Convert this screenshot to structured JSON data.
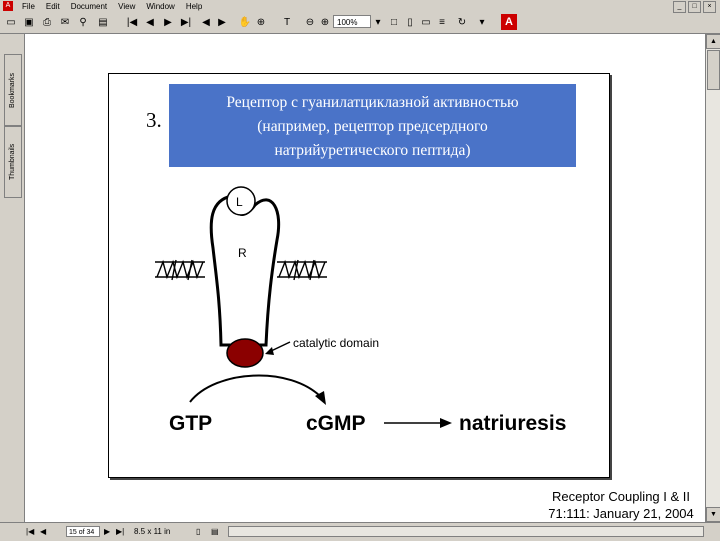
{
  "window": {
    "app_icon": "adobe-reader-icon",
    "menus": [
      "File",
      "Edit",
      "Document",
      "View",
      "Window",
      "Help"
    ],
    "controls": [
      "_",
      "□",
      "×"
    ]
  },
  "toolbar": {
    "zoom_value": "100%",
    "adobe_logo_letter": "A"
  },
  "left_panel": {
    "tabs": [
      "Bookmarks",
      "Thumbnails"
    ]
  },
  "status": {
    "page_indicator": "15 of 34",
    "page_size": "8.5 x 11 in"
  },
  "slide": {
    "number": "3.",
    "title_lines": [
      "Рецептор с гуанилатциклазной активностью",
      "(например, рецептор предсердного",
      "натрийуретического пептида)"
    ],
    "diagram": {
      "ligand_label": "L",
      "receptor_label": "R",
      "domain_label": "catalytic domain",
      "substrate": "GTP",
      "product": "cGMP",
      "effect": "natriuresis"
    },
    "colors": {
      "title_box": "#4a73c8",
      "catalytic_domain": "#8b0000"
    }
  },
  "caption": {
    "line1": "Receptor Coupling I & II",
    "line2": "71:111: January 21, 2004"
  }
}
